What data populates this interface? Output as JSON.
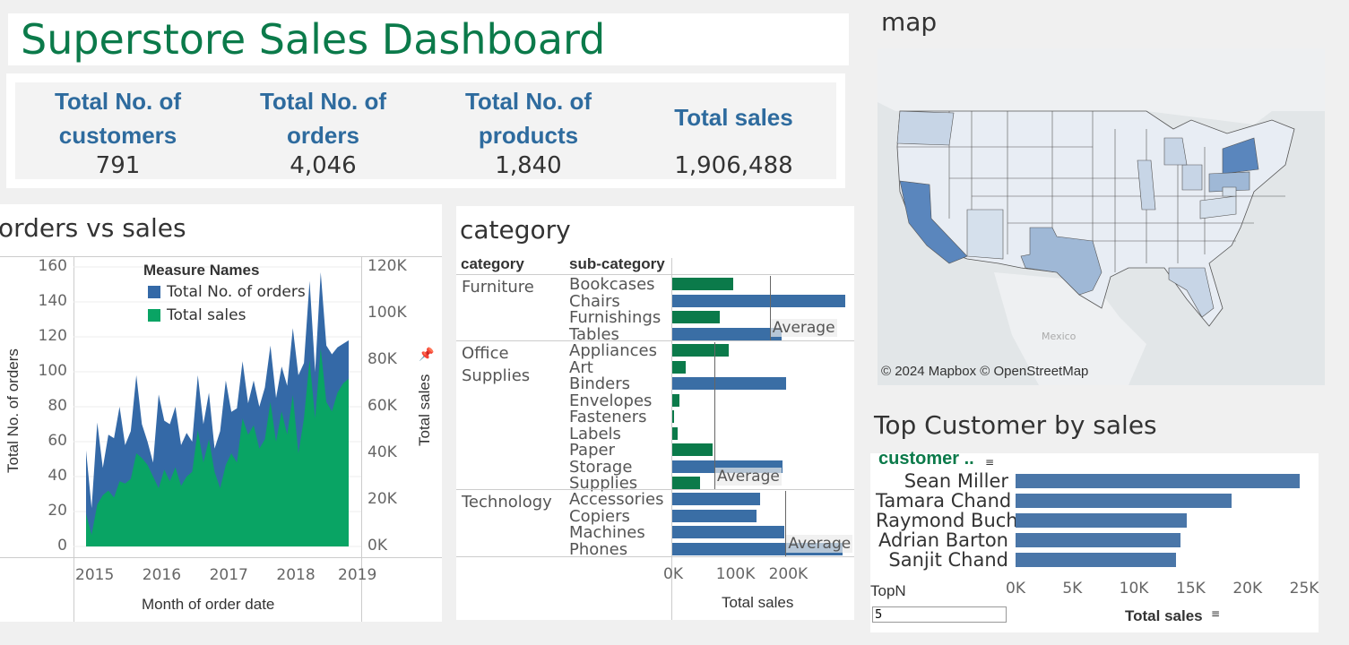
{
  "header": {
    "title": "Superstore Sales Dashboard"
  },
  "kpis": [
    {
      "label": "Total No. of customers",
      "value": "791"
    },
    {
      "label": "Total No. of orders",
      "value": "4,046"
    },
    {
      "label": "Total No. of products",
      "value": "1,840"
    },
    {
      "label": "Total sales",
      "value": "1,906,488"
    }
  ],
  "map": {
    "title": "map",
    "attribution": "© 2024 Mapbox © OpenStreetMap",
    "country_label": "Mexico",
    "colors": {
      "water": "#e2e6e8",
      "land": "#eef0f2",
      "state": "#e8edf4",
      "light": "#c7d5e6",
      "medium": "#9fb8d6",
      "dark": "#5a86bd"
    }
  },
  "orders_vs_sales": {
    "title": "orders vs sales",
    "legend_title": "Measure Names",
    "series_labels": [
      "Total No. of orders",
      "Total sales"
    ],
    "ylabel_left": "Total No. of orders",
    "ylabel_right": "Total sales",
    "xlabel": "Month of order date",
    "y_ticks": [
      "160",
      "140",
      "120",
      "100",
      "80",
      "60",
      "40",
      "20",
      "0"
    ],
    "y2_ticks": [
      "120K",
      "100K",
      "80K",
      "60K",
      "40K",
      "20K",
      "0K"
    ],
    "x_ticks": [
      "2015",
      "2016",
      "2017",
      "2018",
      "2019"
    ],
    "colors": {
      "orders": "#3469a7",
      "sales": "#09a464"
    }
  },
  "category_chart": {
    "title": "category",
    "col_category": "category",
    "col_subcategory": "sub-category",
    "xlabel": "Total sales",
    "x_ticks": [
      "0K",
      "100K",
      "200K"
    ],
    "average_label": "Average",
    "groups": [
      {
        "name_lines": [
          "Furniture"
        ],
        "items": [
          {
            "name": "Bookcases",
            "value": 115000,
            "color": "#0b7a4a"
          },
          {
            "name": "Chairs",
            "value": 328000,
            "color": "#3a6ea5"
          },
          {
            "name": "Furnishings",
            "value": 90000,
            "color": "#0b7a4a"
          },
          {
            "name": "Tables",
            "value": 207000,
            "color": "#3a6ea5"
          }
        ],
        "average": 185000
      },
      {
        "name_lines": [
          "Office",
          "Supplies"
        ],
        "items": [
          {
            "name": "Appliances",
            "value": 108000,
            "color": "#0b7a4a"
          },
          {
            "name": "Art",
            "value": 26000,
            "color": "#0b7a4a"
          },
          {
            "name": "Binders",
            "value": 216000,
            "color": "#3a6ea5"
          },
          {
            "name": "Envelopes",
            "value": 14000,
            "color": "#0b7a4a"
          },
          {
            "name": "Fasteners",
            "value": 3000,
            "color": "#0b7a4a"
          },
          {
            "name": "Labels",
            "value": 11000,
            "color": "#0b7a4a"
          },
          {
            "name": "Paper",
            "value": 77000,
            "color": "#0b7a4a"
          },
          {
            "name": "Storage",
            "value": 210000,
            "color": "#3a6ea5"
          },
          {
            "name": "Supplies",
            "value": 52000,
            "color": "#0b7a4a"
          }
        ],
        "average": 80000
      },
      {
        "name_lines": [
          "Technology"
        ],
        "items": [
          {
            "name": "Accessories",
            "value": 167000,
            "color": "#3a6ea5"
          },
          {
            "name": "Copiers",
            "value": 160000,
            "color": "#3a6ea5"
          },
          {
            "name": "Machines",
            "value": 212000,
            "color": "#3a6ea5"
          },
          {
            "name": "Phones",
            "value": 323000,
            "color": "#3a6ea5"
          }
        ],
        "average": 215000
      }
    ]
  },
  "top_customers": {
    "title": "Top Customer by sales",
    "col_header": "customer ..",
    "xlabel": "Total sales",
    "x_ticks": [
      "0K",
      "5K",
      "10K",
      "15K",
      "20K",
      "25K"
    ],
    "topn_label": "TopN",
    "topn_value": "5",
    "bar_color": "#4a76a8",
    "customers": [
      {
        "name": "Sean Miller",
        "value": 25000
      },
      {
        "name": "Tamara Chand",
        "value": 19000
      },
      {
        "name": "Raymond Buch",
        "value": 15100
      },
      {
        "name": "Adrian Barton",
        "value": 14500
      },
      {
        "name": "Sanjit Chand",
        "value": 14100
      }
    ]
  },
  "chart_data": [
    {
      "type": "area",
      "title": "orders vs sales",
      "xlabel": "Month of order date",
      "ylabel": "Total No. of orders",
      "y2label": "Total sales",
      "ylim": [
        0,
        160
      ],
      "y2lim": [
        0,
        120000
      ],
      "x": [
        "2015-01",
        "2015-02",
        "2015-03",
        "2015-04",
        "2015-05",
        "2015-06",
        "2015-07",
        "2015-08",
        "2015-09",
        "2015-10",
        "2015-11",
        "2015-12",
        "2016-01",
        "2016-02",
        "2016-03",
        "2016-04",
        "2016-05",
        "2016-06",
        "2016-07",
        "2016-08",
        "2016-09",
        "2016-10",
        "2016-11",
        "2016-12",
        "2017-01",
        "2017-02",
        "2017-03",
        "2017-04",
        "2017-05",
        "2017-06",
        "2017-07",
        "2017-08",
        "2017-09",
        "2017-10",
        "2017-11",
        "2017-12",
        "2018-01",
        "2018-02",
        "2018-03",
        "2018-04",
        "2018-05",
        "2018-06",
        "2018-07",
        "2018-08",
        "2018-09",
        "2018-10",
        "2018-11",
        "2018-12"
      ],
      "series": [
        {
          "name": "Total No. of orders",
          "axis": "left",
          "values": [
            55,
            22,
            71,
            45,
            64,
            62,
            80,
            58,
            66,
            98,
            70,
            60,
            48,
            87,
            72,
            70,
            80,
            58,
            65,
            60,
            98,
            70,
            88,
            56,
            66,
            95,
            77,
            79,
            106,
            82,
            95,
            80,
            91,
            115,
            85,
            103,
            92,
            125,
            98,
            105,
            152,
            100,
            157,
            115,
            110,
            114,
            116,
            118
          ]
        },
        {
          "name": "Total sales",
          "axis": "right",
          "values": [
            14000,
            5000,
            18000,
            22000,
            24000,
            21000,
            28000,
            27000,
            29000,
            40000,
            38000,
            35000,
            30000,
            25000,
            33000,
            28000,
            34000,
            26000,
            30000,
            32000,
            50000,
            36000,
            46000,
            32000,
            25000,
            35000,
            40000,
            36000,
            55000,
            48000,
            52000,
            42000,
            46000,
            62000,
            45000,
            58000,
            48000,
            65000,
            40000,
            55000,
            80000,
            55000,
            85000,
            62000,
            58000,
            66000,
            70000,
            72000
          ]
        }
      ]
    },
    {
      "type": "bar",
      "title": "category",
      "xlabel": "Total sales",
      "categories": [
        "Bookcases",
        "Chairs",
        "Furnishings",
        "Tables",
        "Appliances",
        "Art",
        "Binders",
        "Envelopes",
        "Fasteners",
        "Labels",
        "Paper",
        "Storage",
        "Supplies",
        "Accessories",
        "Copiers",
        "Machines",
        "Phones"
      ],
      "values": [
        115000,
        328000,
        90000,
        207000,
        108000,
        26000,
        216000,
        14000,
        3000,
        11000,
        77000,
        210000,
        52000,
        167000,
        160000,
        212000,
        323000
      ],
      "xlim": [
        0,
        330000
      ]
    },
    {
      "type": "bar",
      "title": "Top Customer by sales",
      "xlabel": "Total sales",
      "categories": [
        "Sean Miller",
        "Tamara Chand",
        "Raymond Buch",
        "Adrian Barton",
        "Sanjit Chand"
      ],
      "values": [
        25000,
        19000,
        15100,
        14500,
        14100
      ],
      "xlim": [
        0,
        25500
      ]
    }
  ]
}
